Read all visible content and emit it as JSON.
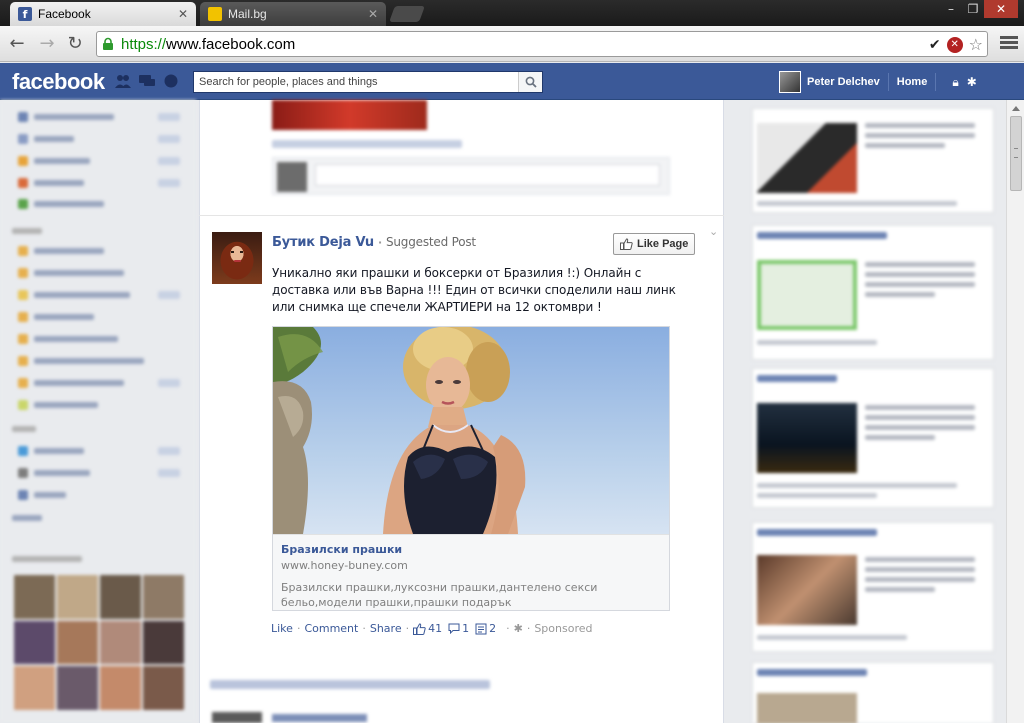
{
  "browser": {
    "tabs": [
      {
        "title": "Facebook",
        "active": true,
        "favicon": "facebook-favicon"
      },
      {
        "title": "Mail.bg",
        "active": false,
        "favicon": "mailbg-favicon"
      }
    ],
    "url_scheme": "https://",
    "url_host": "www.facebook.com",
    "colors": {
      "secure_green": "#0a8a0a"
    }
  },
  "fb": {
    "logo": "facebook",
    "search_placeholder": "Search for people, places and things",
    "user_name": "Peter Delchev",
    "home_label": "Home",
    "colors": {
      "brand_blue": "#3b5998",
      "link_blue": "#3b5998"
    }
  },
  "post": {
    "page_name": "Бутик Deja Vu",
    "meta_label": "Suggested Post",
    "like_page_label": "Like Page",
    "text": "Уникално яки прашки и боксерки от Бразилия !:) Онлайн с доставка или във Варна !!! Един от всички споделили наш линк или снимка ще спечели ЖАРТИЕРИ на 12 октомври !",
    "attachment": {
      "title": "Бразилски прашки",
      "domain": "www.honey-buney.com",
      "description": "Бразилски прашки,луксозни прашки,дантелено секси бельо,модели прашки,прашки подарък"
    },
    "actions": {
      "like": "Like",
      "comment": "Comment",
      "share": "Share",
      "likes_count": "41",
      "comments_count": "1",
      "shares_count": "2",
      "sponsored": "Sponsored"
    }
  }
}
